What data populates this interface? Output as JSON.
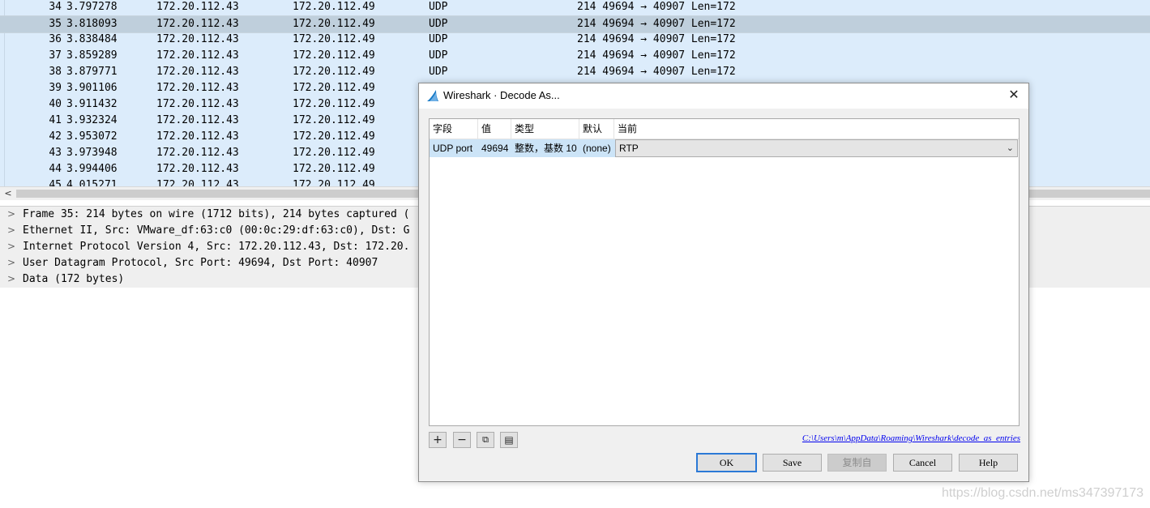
{
  "packet_list": {
    "rows": [
      {
        "no": "34",
        "time": "3.797278",
        "src": "172.20.112.43",
        "dst": "172.20.112.49",
        "proto": "UDP",
        "info": "214 49694 → 40907 Len=172",
        "selected": false
      },
      {
        "no": "35",
        "time": "3.818093",
        "src": "172.20.112.43",
        "dst": "172.20.112.49",
        "proto": "UDP",
        "info": "214 49694 → 40907 Len=172",
        "selected": true
      },
      {
        "no": "36",
        "time": "3.838484",
        "src": "172.20.112.43",
        "dst": "172.20.112.49",
        "proto": "UDP",
        "info": "214 49694 → 40907 Len=172",
        "selected": false
      },
      {
        "no": "37",
        "time": "3.859289",
        "src": "172.20.112.43",
        "dst": "172.20.112.49",
        "proto": "UDP",
        "info": "214 49694 → 40907 Len=172",
        "selected": false
      },
      {
        "no": "38",
        "time": "3.879771",
        "src": "172.20.112.43",
        "dst": "172.20.112.49",
        "proto": "UDP",
        "info": "214 49694 → 40907 Len=172",
        "selected": false
      },
      {
        "no": "39",
        "time": "3.901106",
        "src": "172.20.112.43",
        "dst": "172.20.112.49",
        "proto": "",
        "info": "",
        "selected": false
      },
      {
        "no": "40",
        "time": "3.911432",
        "src": "172.20.112.43",
        "dst": "172.20.112.49",
        "proto": "",
        "info": "",
        "selected": false
      },
      {
        "no": "41",
        "time": "3.932324",
        "src": "172.20.112.43",
        "dst": "172.20.112.49",
        "proto": "",
        "info": "",
        "selected": false
      },
      {
        "no": "42",
        "time": "3.953072",
        "src": "172.20.112.43",
        "dst": "172.20.112.49",
        "proto": "",
        "info": "",
        "selected": false
      },
      {
        "no": "43",
        "time": "3.973948",
        "src": "172.20.112.43",
        "dst": "172.20.112.49",
        "proto": "",
        "info": "",
        "selected": false
      },
      {
        "no": "44",
        "time": "3.994406",
        "src": "172.20.112.43",
        "dst": "172.20.112.49",
        "proto": "",
        "info": "",
        "selected": false
      },
      {
        "no": "45",
        "time": "4.015271",
        "src": "172.20.112.43",
        "dst": "172.20.112.49",
        "proto": "",
        "info": "",
        "selected": false
      }
    ]
  },
  "scrollbar": {
    "left_arrow": "<"
  },
  "details": {
    "rows": [
      {
        "arrow": ">",
        "text": "Frame 35: 214 bytes on wire (1712 bits), 214 bytes captured ("
      },
      {
        "arrow": ">",
        "text": "Ethernet II, Src: VMware_df:63:c0 (00:0c:29:df:63:c0), Dst: G"
      },
      {
        "arrow": ">",
        "text": "Internet Protocol Version 4, Src: 172.20.112.43, Dst: 172.20."
      },
      {
        "arrow": ">",
        "text": "User Datagram Protocol, Src Port: 49694, Dst Port: 40907"
      },
      {
        "arrow": ">",
        "text": "Data (172 bytes)"
      }
    ]
  },
  "dialog": {
    "title": "Wireshark · Decode As...",
    "close": "✕",
    "headers": {
      "field": "字段",
      "value": "值",
      "type": "类型",
      "default": "默认",
      "current": "当前"
    },
    "row": {
      "field": "UDP port",
      "value": "49694",
      "type": "整数，基数 10",
      "default": "(none)",
      "current": "RTP"
    },
    "combo_arrow": "⌄",
    "toolbar": {
      "add": "+",
      "remove": "−",
      "copy": "⧉",
      "clear": "▤"
    },
    "path": "C:\\Users\\m\\AppData\\Roaming\\Wireshark\\decode_as_entries",
    "buttons": {
      "ok": "OK",
      "save": "Save",
      "copy_from": "复制自",
      "cancel": "Cancel",
      "help": "Help"
    }
  },
  "watermark": "https://blog.csdn.net/ms347397173",
  "colors": {
    "list_bg": "#dcecfb",
    "selected_row": "#bfcfdc",
    "link": "#0000ee",
    "ok_border": "#2b79d6"
  }
}
